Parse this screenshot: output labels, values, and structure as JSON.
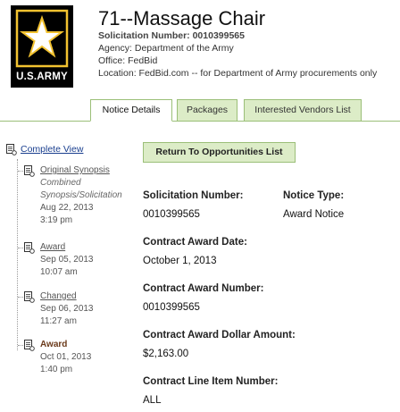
{
  "header": {
    "logo_text": "U.S.ARMY",
    "title": "71--Massage Chair",
    "solicitation_line": "Solicitation Number: 0010399565",
    "agency_line": "Agency: Department of the Army",
    "office_line": "Office: FedBid",
    "location_line": "Location: FedBid.com -- for Department of Army procurements only"
  },
  "tabs": [
    {
      "label": "Notice Details",
      "active": true
    },
    {
      "label": "Packages",
      "active": false
    },
    {
      "label": "Interested Vendors List",
      "active": false
    }
  ],
  "sidebar": {
    "complete_view": "Complete View",
    "items": [
      {
        "title": "Original Synopsis",
        "sub1": "Combined",
        "sub2": "Synopsis/Solicitation",
        "date": "Aug 22, 2013",
        "time": "3:19 pm",
        "current": false
      },
      {
        "title": "Award",
        "date": "Sep 05, 2013",
        "time": "10:07 am",
        "current": false
      },
      {
        "title": "Changed",
        "date": "Sep 06, 2013",
        "time": "11:27 am",
        "current": false
      },
      {
        "title": "Award",
        "date": "Oct 01, 2013",
        "time": "1:40 pm",
        "current": true
      }
    ]
  },
  "main": {
    "return_button": "Return To Opportunities List",
    "fields": {
      "solicitation_number": {
        "label": "Solicitation Number:",
        "value": "0010399565"
      },
      "notice_type": {
        "label": "Notice Type:",
        "value": "Award Notice"
      },
      "contract_award_date": {
        "label": "Contract Award Date:",
        "value": "October 1, 2013"
      },
      "contract_award_number": {
        "label": "Contract Award Number:",
        "value": "0010399565"
      },
      "contract_award_dollar_amount": {
        "label": "Contract Award Dollar Amount:",
        "value": "$2,163.00"
      },
      "contract_line_item_number": {
        "label": "Contract Line Item Number:",
        "value": "ALL"
      }
    }
  },
  "colors": {
    "tab_border": "#9bbf78",
    "tab_inactive_bg": "#dcecc7",
    "link_blue": "#1a3f8f",
    "current_item": "#6b3a1a",
    "logo_gold": "#f2c230"
  }
}
